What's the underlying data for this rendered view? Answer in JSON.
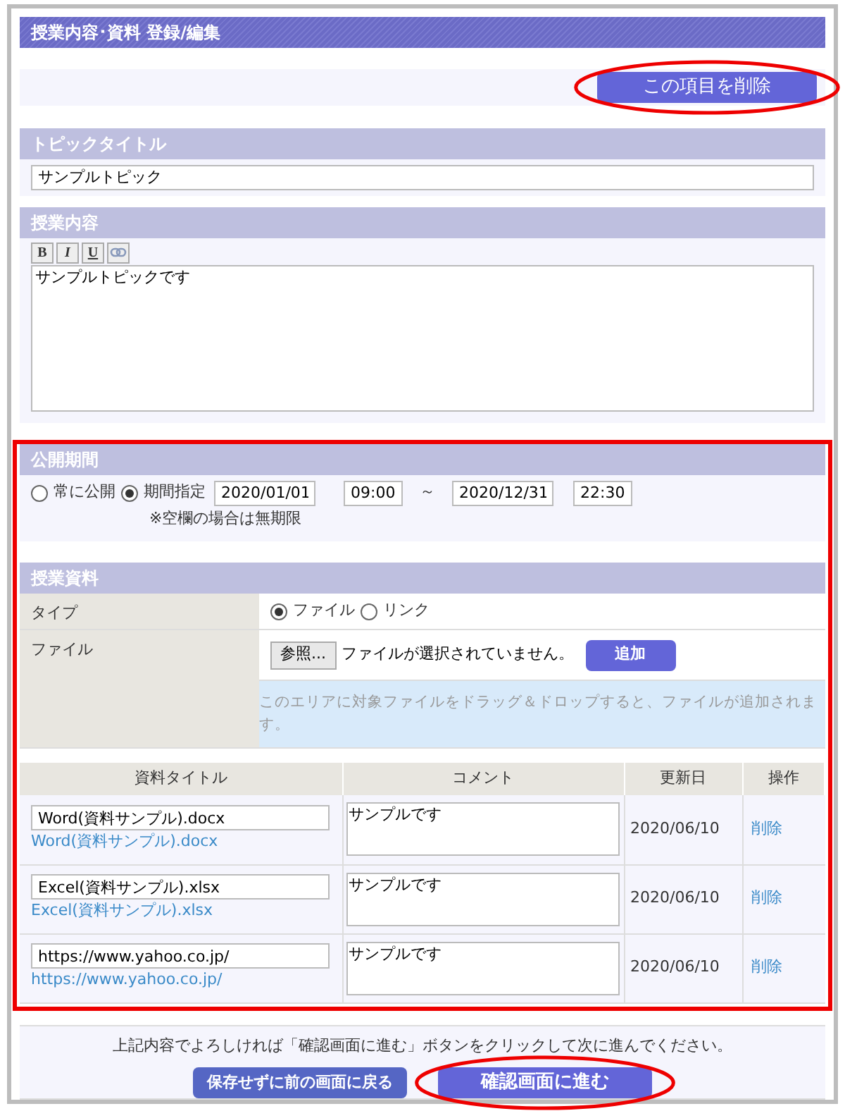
{
  "page_title": "授業内容･資料 登録/編集",
  "delete_button": "この項目を削除",
  "topic_title": {
    "heading": "トピックタイトル",
    "value": "サンプルトピック"
  },
  "lesson_content": {
    "heading": "授業内容",
    "toolbar": [
      {
        "label": "B",
        "kind": "bold"
      },
      {
        "label": "I",
        "kind": "italic"
      },
      {
        "label": "U",
        "kind": "underline"
      },
      {
        "kind": "link"
      }
    ],
    "value": "サンプルトピックです"
  },
  "publish_period": {
    "heading": "公開期間",
    "options": [
      {
        "label": "常に公開",
        "selected": false
      },
      {
        "label": "期間指定",
        "selected": true
      }
    ],
    "start_date": "2020/01/01",
    "start_time": "09:00",
    "separator": "～",
    "end_date": "2020/12/31",
    "end_time": "22:30",
    "note": "※空欄の場合は無期限"
  },
  "materials": {
    "heading": "授業資料",
    "type_label": "タイプ",
    "type_options": [
      {
        "label": "ファイル",
        "selected": true
      },
      {
        "label": "リンク",
        "selected": false
      }
    ],
    "file_label": "ファイル",
    "browse_button": "参照...",
    "file_status": "ファイルが選択されていません。",
    "add_button": "追加",
    "drop_hint": "このエリアに対象ファイルをドラッグ＆ドロップすると、ファイルが追加されます。",
    "table": {
      "columns": [
        "資料タイトル",
        "コメント",
        "更新日",
        "操作"
      ],
      "rows": [
        {
          "title": "Word(資料サンプル).docx",
          "link": "Word(資料サンプル).docx",
          "comment": "サンプルです",
          "updated": "2020/06/10",
          "action": "削除"
        },
        {
          "title": "Excel(資料サンプル).xlsx",
          "link": "Excel(資料サンプル).xlsx",
          "comment": "サンプルです",
          "updated": "2020/06/10",
          "action": "削除"
        },
        {
          "title": "https://www.yahoo.co.jp/",
          "link": "https://www.yahoo.co.jp/",
          "comment": "サンプルです",
          "updated": "2020/06/10",
          "action": "削除"
        }
      ]
    }
  },
  "footer": {
    "message": "上記内容でよろしければ「確認画面に進む」ボタンをクリックして次に進んでください。",
    "back_button": "保存せずに前の画面に戻る",
    "next_button": "確認画面に進む"
  }
}
